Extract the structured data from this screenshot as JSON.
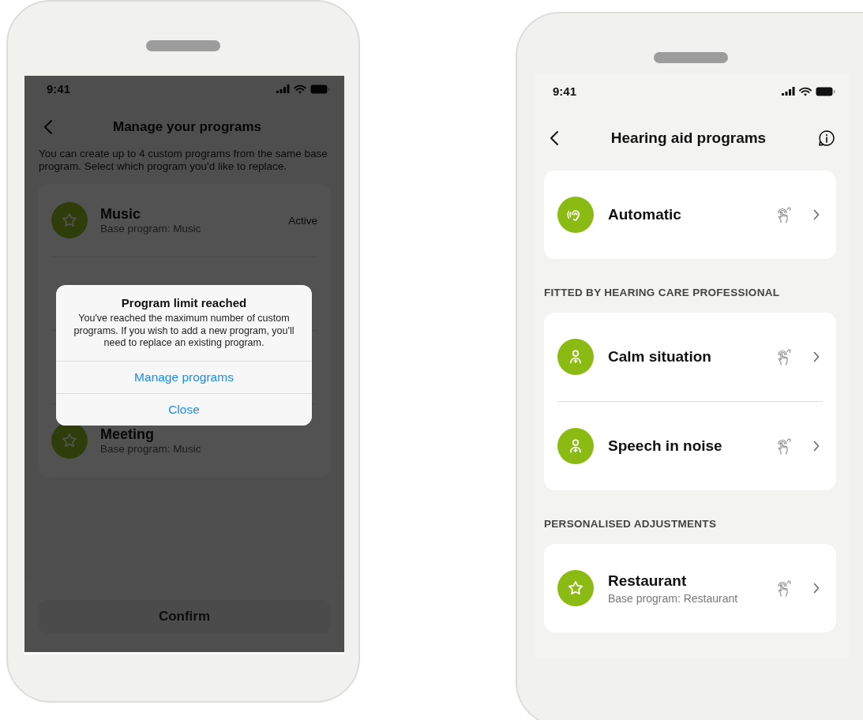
{
  "left_phone": {
    "status_time": "9:41",
    "title": "Manage your programs",
    "description": "You can create up to 4 custom programs from the same base program. Select which program you'd like to replace.",
    "programs": [
      {
        "name": "Music",
        "subtitle": "Base program: Music",
        "status": "Active",
        "kind": "custom"
      },
      {
        "name": "Meeting",
        "subtitle": "Base program: Music",
        "kind": "custom"
      }
    ],
    "confirm_button": {
      "label": "Confirm",
      "disabled": true
    },
    "dialog": {
      "title": "Program limit reached",
      "message": "You've reached the maximum number of custom programs. If you wish to add a new program, you'll need to replace an existing program.",
      "buttons": [
        "Manage programs",
        "Close"
      ]
    }
  },
  "right_phone": {
    "status_time": "9:41",
    "title": "Hearing aid programs",
    "sections": [
      {
        "items": [
          {
            "name": "Automatic",
            "kind": "automatic"
          }
        ]
      },
      {
        "heading": "FITTED BY HEARING CARE PROFESSIONAL",
        "items": [
          {
            "name": "Calm situation",
            "kind": "fitted"
          },
          {
            "name": "Speech in noise",
            "kind": "fitted"
          }
        ]
      },
      {
        "heading": "PERSONALISED ADJUSTMENTS",
        "items": [
          {
            "name": "Restaurant",
            "subtitle": "Base program: Restaurant",
            "kind": "custom"
          }
        ]
      }
    ]
  }
}
